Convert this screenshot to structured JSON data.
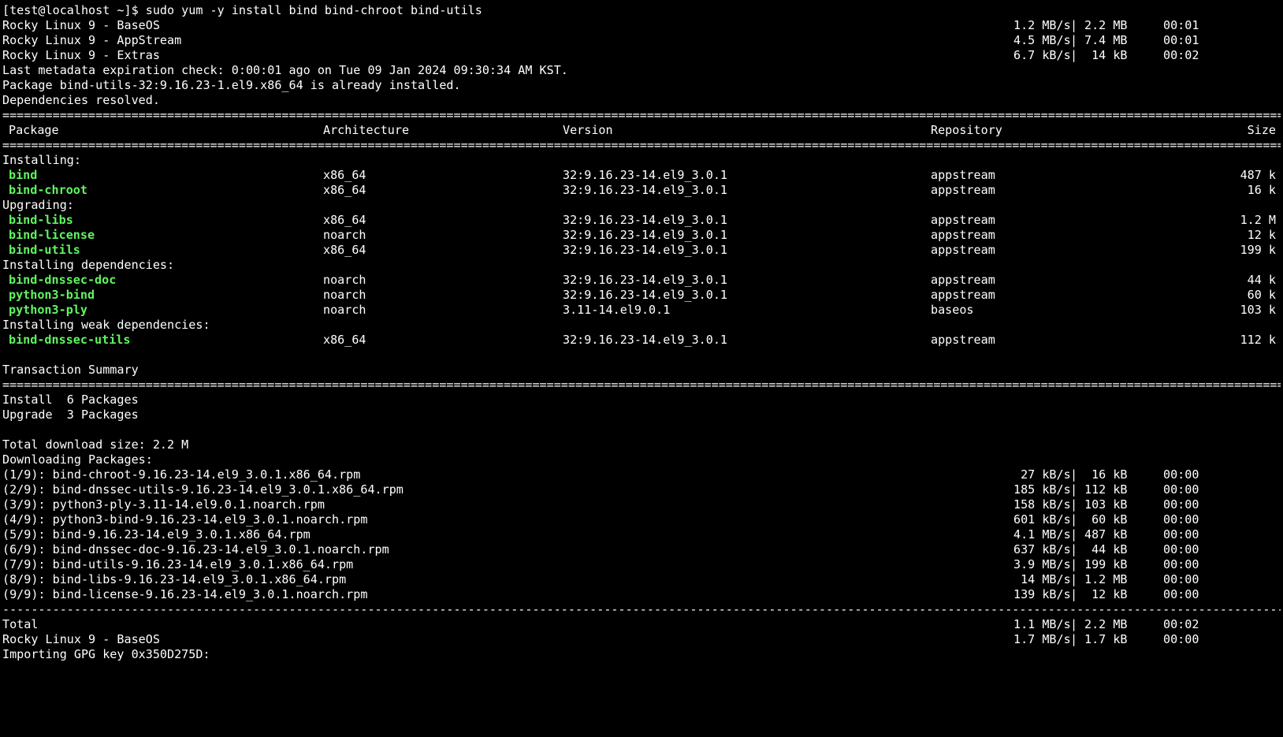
{
  "terminal": {
    "prompt": "[test@localhost ~]$ sudo yum -y install bind bind-chroot bind-utils",
    "repo_lines": [
      {
        "name": "Rocky Linux 9 - BaseOS",
        "rate": "1.2 MB/s",
        "size": "2.2 MB",
        "time": "00:01"
      },
      {
        "name": "Rocky Linux 9 - AppStream",
        "rate": "4.5 MB/s",
        "size": "7.4 MB",
        "time": "00:01"
      },
      {
        "name": "Rocky Linux 9 - Extras",
        "rate": "6.7 kB/s",
        "size": " 14 kB",
        "time": "00:02"
      }
    ],
    "metadata_line": "Last metadata expiration check: 0:00:01 ago on Tue 09 Jan 2024 09:30:34 AM KST.",
    "already_installed": "Package bind-utils-32:9.16.23-1.el9.x86_64 is already installed.",
    "deps_resolved": "Dependencies resolved.",
    "table_headers": {
      "package": "Package",
      "arch": "Architecture",
      "version": "Version",
      "repo": "Repository",
      "size": "Size"
    },
    "sections": [
      {
        "title": "Installing:",
        "rows": [
          {
            "package": "bind",
            "arch": "x86_64",
            "version": "32:9.16.23-14.el9_3.0.1",
            "repo": "appstream",
            "size": "487 k"
          },
          {
            "package": "bind-chroot",
            "arch": "x86_64",
            "version": "32:9.16.23-14.el9_3.0.1",
            "repo": "appstream",
            "size": "16 k"
          }
        ]
      },
      {
        "title": "Upgrading:",
        "rows": [
          {
            "package": "bind-libs",
            "arch": "x86_64",
            "version": "32:9.16.23-14.el9_3.0.1",
            "repo": "appstream",
            "size": "1.2 M"
          },
          {
            "package": "bind-license",
            "arch": "noarch",
            "version": "32:9.16.23-14.el9_3.0.1",
            "repo": "appstream",
            "size": "12 k"
          },
          {
            "package": "bind-utils",
            "arch": "x86_64",
            "version": "32:9.16.23-14.el9_3.0.1",
            "repo": "appstream",
            "size": "199 k"
          }
        ]
      },
      {
        "title": "Installing dependencies:",
        "rows": [
          {
            "package": "bind-dnssec-doc",
            "arch": "noarch",
            "version": "32:9.16.23-14.el9_3.0.1",
            "repo": "appstream",
            "size": "44 k"
          },
          {
            "package": "python3-bind",
            "arch": "noarch",
            "version": "32:9.16.23-14.el9_3.0.1",
            "repo": "appstream",
            "size": "60 k"
          },
          {
            "package": "python3-ply",
            "arch": "noarch",
            "version": "3.11-14.el9.0.1",
            "repo": "baseos",
            "size": "103 k"
          }
        ]
      },
      {
        "title": "Installing weak dependencies:",
        "rows": [
          {
            "package": "bind-dnssec-utils",
            "arch": "x86_64",
            "version": "32:9.16.23-14.el9_3.0.1",
            "repo": "appstream",
            "size": "112 k"
          }
        ]
      }
    ],
    "transaction_summary": "Transaction Summary",
    "install_summary": "Install  6 Packages",
    "upgrade_summary": "Upgrade  3 Packages",
    "total_download": "Total download size: 2.2 M",
    "downloading": "Downloading Packages:",
    "downloads": [
      {
        "file": "(1/9): bind-chroot-9.16.23-14.el9_3.0.1.x86_64.rpm",
        "rate": " 27 kB/s",
        "size": " 16 kB",
        "time": "00:00"
      },
      {
        "file": "(2/9): bind-dnssec-utils-9.16.23-14.el9_3.0.1.x86_64.rpm",
        "rate": "185 kB/s",
        "size": "112 kB",
        "time": "00:00"
      },
      {
        "file": "(3/9): python3-ply-3.11-14.el9.0.1.noarch.rpm",
        "rate": "158 kB/s",
        "size": "103 kB",
        "time": "00:00"
      },
      {
        "file": "(4/9): python3-bind-9.16.23-14.el9_3.0.1.noarch.rpm",
        "rate": "601 kB/s",
        "size": " 60 kB",
        "time": "00:00"
      },
      {
        "file": "(5/9): bind-9.16.23-14.el9_3.0.1.x86_64.rpm",
        "rate": "4.1 MB/s",
        "size": "487 kB",
        "time": "00:00"
      },
      {
        "file": "(6/9): bind-dnssec-doc-9.16.23-14.el9_3.0.1.noarch.rpm",
        "rate": "637 kB/s",
        "size": " 44 kB",
        "time": "00:00"
      },
      {
        "file": "(7/9): bind-utils-9.16.23-14.el9_3.0.1.x86_64.rpm",
        "rate": "3.9 MB/s",
        "size": "199 kB",
        "time": "00:00"
      },
      {
        "file": "(8/9): bind-libs-9.16.23-14.el9_3.0.1.x86_64.rpm",
        "rate": " 14 MB/s",
        "size": "1.2 MB",
        "time": "00:00"
      },
      {
        "file": "(9/9): bind-license-9.16.23-14.el9_3.0.1.noarch.rpm",
        "rate": "139 kB/s",
        "size": " 12 kB",
        "time": "00:00"
      }
    ],
    "total_lines": [
      {
        "name": "Total",
        "rate": "1.1 MB/s",
        "size": "2.2 MB",
        "time": "00:02"
      },
      {
        "name": "Rocky Linux 9 - BaseOS",
        "rate": "1.7 MB/s",
        "size": "1.7 kB",
        "time": "00:00"
      }
    ],
    "gpg_line": "Importing GPG key 0x350D275D:"
  },
  "colors": {
    "background": "#000000",
    "text": "#ffffff",
    "package": "#5ff65f"
  }
}
